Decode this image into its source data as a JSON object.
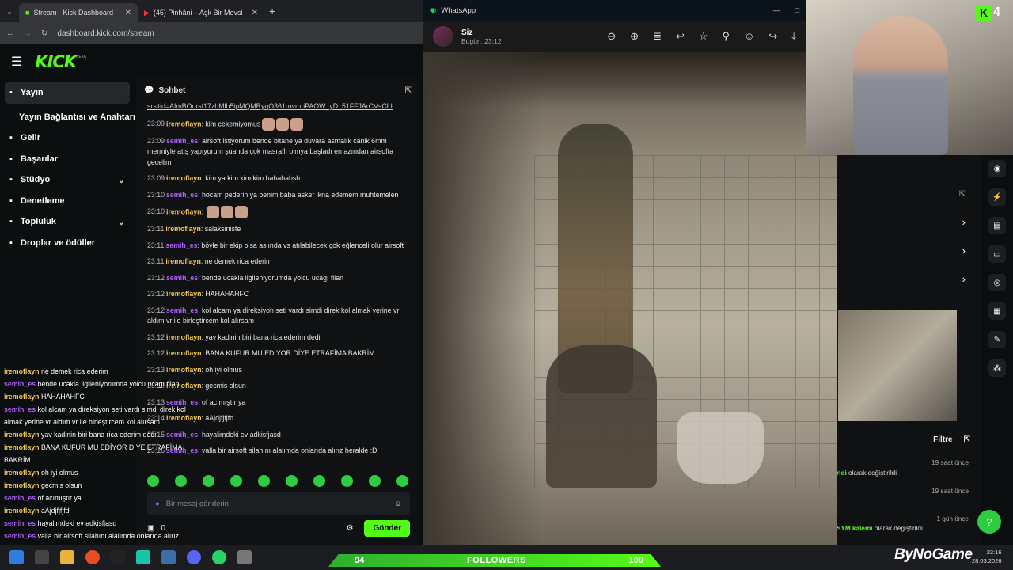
{
  "browser": {
    "tabs": [
      {
        "label": "Stream - Kick Dashboard",
        "active": true
      },
      {
        "label": "(45) Pinhâni – Aşk Bir Mevsi",
        "active": false
      }
    ],
    "url": "dashboard.kick.com/stream"
  },
  "kick": {
    "logo": "KICK",
    "beta": "BETA",
    "nav": [
      {
        "label": "Yayın",
        "icon": "broadcast-icon",
        "selected": true,
        "chevron": false
      },
      {
        "label": "Yayın Bağlantısı ve Anahtarı",
        "icon": "",
        "selected": false,
        "chevron": false,
        "sub": true
      },
      {
        "label": "Gelir",
        "icon": "income-icon",
        "selected": false,
        "chevron": false
      },
      {
        "label": "Başarılar",
        "icon": "trophy-icon",
        "selected": false,
        "chevron": false
      },
      {
        "label": "Stüdyo",
        "icon": "studio-icon",
        "selected": false,
        "chevron": true
      },
      {
        "label": "Denetleme",
        "icon": "moderation-icon",
        "selected": false,
        "chevron": false
      },
      {
        "label": "Topluluk",
        "icon": "community-icon",
        "selected": false,
        "chevron": true
      },
      {
        "label": "Droplar ve ödüller",
        "icon": "drops-icon",
        "selected": false,
        "chevron": false
      }
    ]
  },
  "chat": {
    "title": "Sohbet",
    "link": "srsltid=AfmBOorsf17zbMlh5ipMQMRyqO361rnvmriPAOW_yD_51FFJArCVsCLI",
    "messages": [
      {
        "time": "23:09",
        "user": "iremoflayn",
        "type": 1,
        "text": "kim cekemiyomus",
        "emotes": 3
      },
      {
        "time": "23:09",
        "user": "semih_es",
        "type": 2,
        "text": "airsoft istiyorum bende bitane ya duvara asmalık canik 6mm mermiyle atış yapıyorum şuanda çok masraflı olmya başladı en azından airsofta gecelim",
        "emotes": 0
      },
      {
        "time": "23:09",
        "user": "iremoflayn",
        "type": 1,
        "text": "kim ya kim kim kim hahahahsh",
        "emotes": 0
      },
      {
        "time": "23:10",
        "user": "semih_es",
        "type": 2,
        "text": "hocam pederin ya benim baba asker ikna edemem muhtemelen",
        "emotes": 0
      },
      {
        "time": "23:10",
        "user": "iremoflayn",
        "type": 1,
        "text": "",
        "emotes": 3
      },
      {
        "time": "23:11",
        "user": "iremoflayn",
        "type": 1,
        "text": "salaksiniste",
        "emotes": 0
      },
      {
        "time": "23:11",
        "user": "semih_es",
        "type": 2,
        "text": "böyle bir ekip olsa aslında vs atılabilecek çok eğlenceli olur airsoft",
        "emotes": 0
      },
      {
        "time": "23:11",
        "user": "iremoflayn",
        "type": 1,
        "text": "ne demek rica ederim",
        "emotes": 0
      },
      {
        "time": "23:12",
        "user": "semih_es",
        "type": 2,
        "text": "bende ucakla ilgileniyorumda yolcu ucagı filan",
        "emotes": 0
      },
      {
        "time": "23:12",
        "user": "iremoflayn",
        "type": 1,
        "text": "HAHAHAHFC",
        "emotes": 0
      },
      {
        "time": "23:12",
        "user": "semih_es",
        "type": 2,
        "text": "kol alcam ya direksiyon seti vardı simdi direk kol almak yerine vr aldım vr ile birleştircem kol alırsam",
        "emotes": 0
      },
      {
        "time": "23:12",
        "user": "iremoflayn",
        "type": 1,
        "text": "yav kadinin biri bana rica ederim dedi",
        "emotes": 0
      },
      {
        "time": "23:12",
        "user": "iremoflayn",
        "type": 1,
        "text": "BANA KUFUR MU EDİYOR DİYE ETRAFİMA BAKRİM",
        "emotes": 0
      },
      {
        "time": "23:13",
        "user": "iremoflayn",
        "type": 1,
        "text": "oh iyi olmus",
        "emotes": 0
      },
      {
        "time": "23:13",
        "user": "iremoflayn",
        "type": 1,
        "text": "gecmis olsun",
        "emotes": 0
      },
      {
        "time": "23:13",
        "user": "semih_es",
        "type": 2,
        "text": "of acımıştır ya",
        "emotes": 0
      },
      {
        "time": "23:14",
        "user": "iremoflayn",
        "type": 1,
        "text": "aAjdjfjfjfd",
        "emotes": 0
      },
      {
        "time": "23:15",
        "user": "semih_es",
        "type": 2,
        "text": "hayalimdeki ev adkisfjasd",
        "emotes": 0
      },
      {
        "time": "23:16",
        "user": "semih_es",
        "type": 2,
        "text": "valla bir airsoft silahını alalımda onlarıda alırız heralde :D",
        "emotes": 0
      }
    ],
    "input_placeholder": "Bir mesaj gönderin",
    "send_label": "Gönder",
    "points": "0"
  },
  "overlay": [
    {
      "user": "iremoflayn",
      "type": 1,
      "text": "ne demek rica ederim"
    },
    {
      "user": "semih_es",
      "type": 2,
      "text": "bende ucakla ilgileniyorumda yolcu ucagı filan"
    },
    {
      "user": "iremoflayn",
      "type": 1,
      "text": "HAHAHAHFC"
    },
    {
      "user": "semih_es",
      "type": 2,
      "text": "kol alcam ya direksiyon seti vardı simdi direk kol almak yerine vr aldım vr ile birleştircem kol alırsam"
    },
    {
      "user": "iremoflayn",
      "type": 1,
      "text": "yav kadinin biri bana rica ederim dedi"
    },
    {
      "user": "iremoflayn",
      "type": 1,
      "text": "BANA KUFUR MU EDİYOR DİYE ETRAFİMA BAKRİM"
    },
    {
      "user": "iremoflayn",
      "type": 1,
      "text": "oh iyi olmus"
    },
    {
      "user": "iremoflayn",
      "type": 1,
      "text": "gecmis olsun"
    },
    {
      "user": "semih_es",
      "type": 2,
      "text": "of acımıştır ya"
    },
    {
      "user": "iremoflayn",
      "type": 1,
      "text": "aAjdjfjfjfd"
    },
    {
      "user": "semih_es",
      "type": 2,
      "text": "hayalimdeki ev adkisfjasd"
    },
    {
      "user": "semih_es",
      "type": 2,
      "text": "valla bir airsoft silahını alalımda onlarıda alırız heralde :D"
    }
  ],
  "whatsapp": {
    "app_title": "WhatsApp",
    "contact": "Siz",
    "subtitle": "Bugün, 23:12"
  },
  "studio": {
    "filter_label": "Filtre",
    "activity": [
      {
        "ago": "19 saat önce",
        "pre": "",
        "name": "rldi",
        "suffix": "olarak değiştirildi"
      },
      {
        "ago": "19 saat önce",
        "pre": "",
        "name": "",
        "suffix": ""
      },
      {
        "ago": "1 gün önce",
        "pre": "",
        "name": "SYM kalemi",
        "suffix": "olarak değiştirildi"
      }
    ]
  },
  "cam": {
    "badge": "4"
  },
  "followers": {
    "label": "FOLLOWERS",
    "current": "94",
    "goal": "100",
    "progress": 0.94
  },
  "watermark": "ByNoGame",
  "clock": {
    "time": "23:16",
    "date": "28.03.2026"
  }
}
